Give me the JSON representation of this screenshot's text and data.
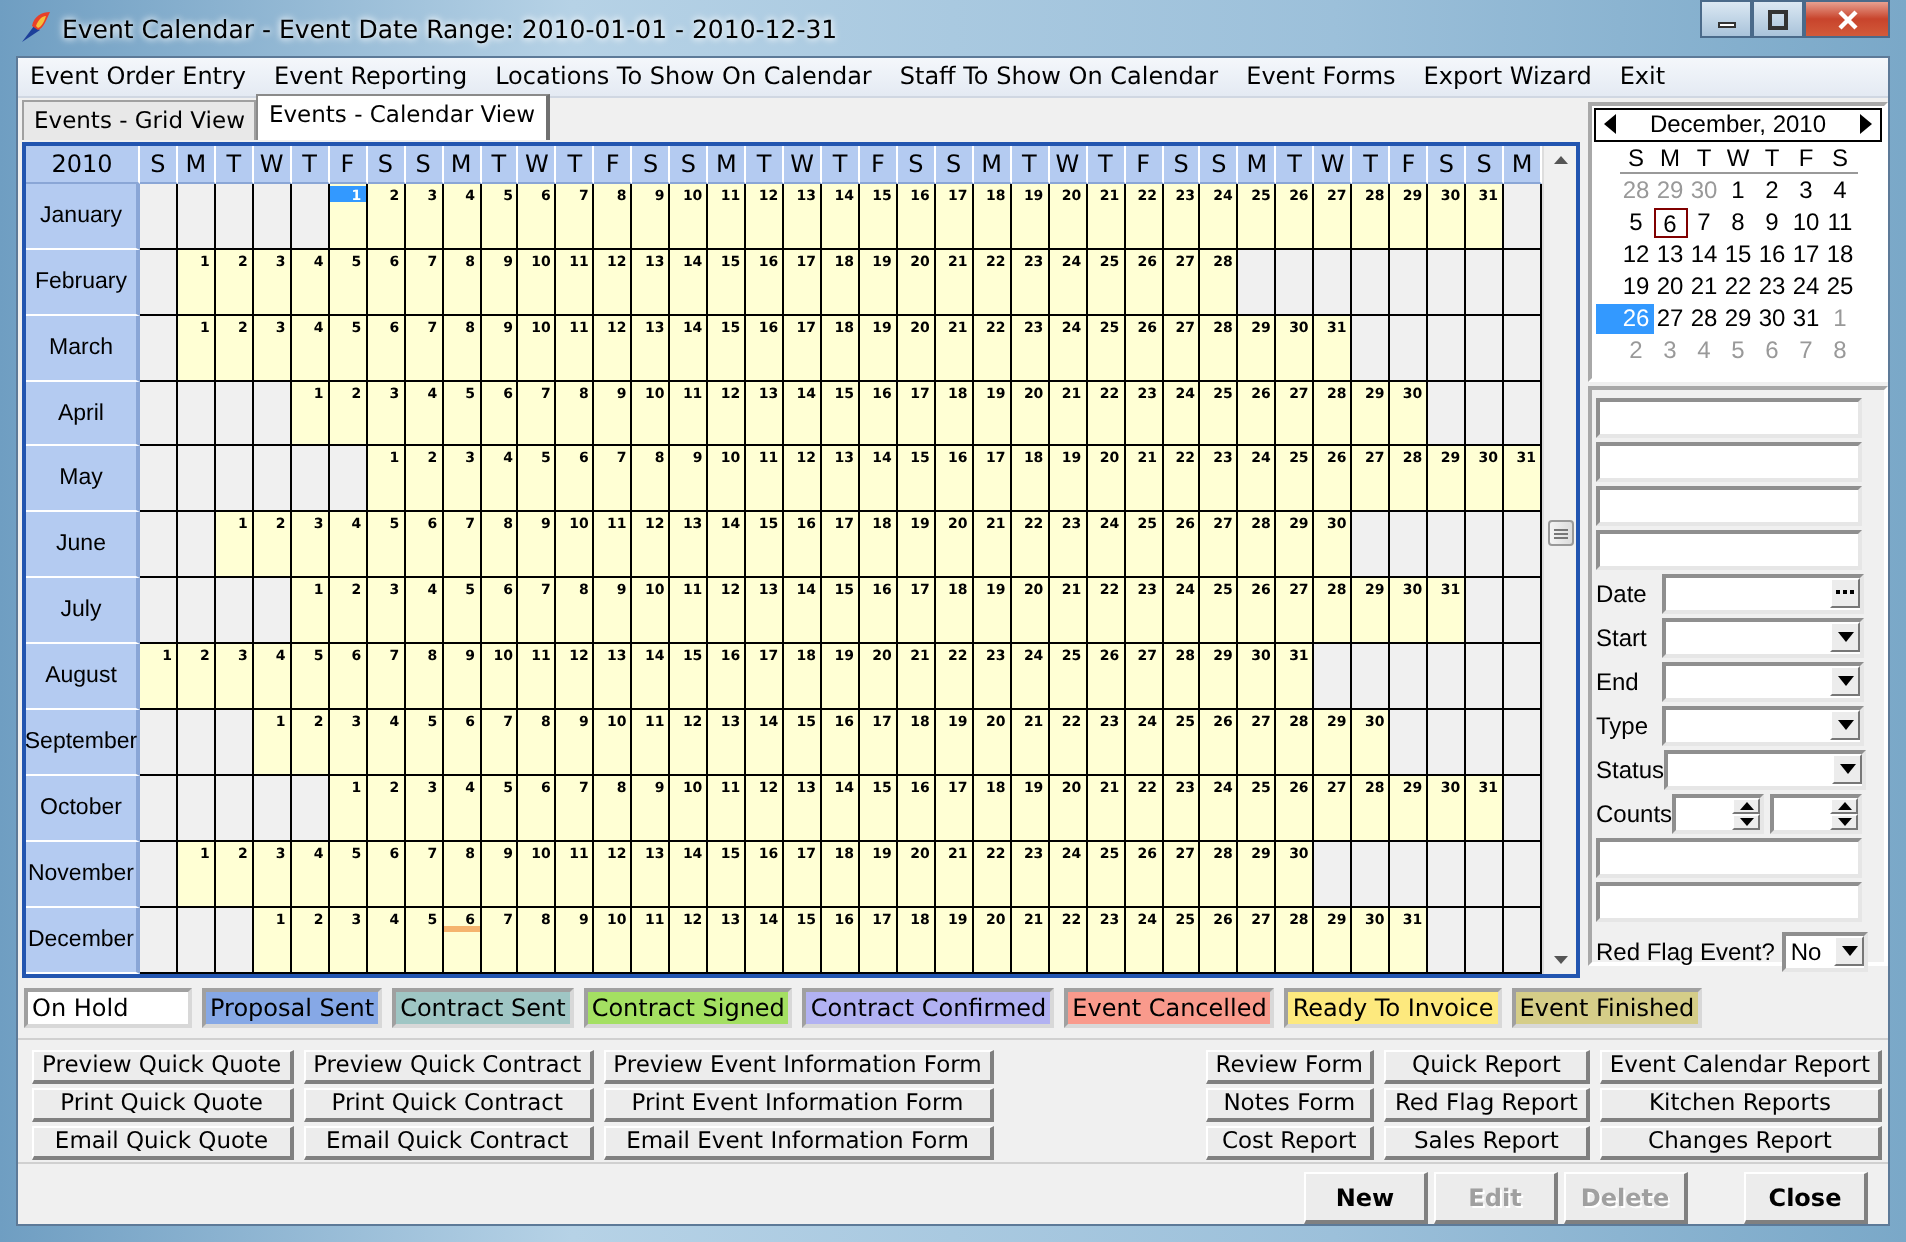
{
  "window": {
    "title": "Event Calendar - Event Date Range: 2010-01-01 - 2010-12-31"
  },
  "menu": [
    "Event Order Entry",
    "Event Reporting",
    "Locations To Show On Calendar",
    "Staff To Show On Calendar",
    "Event Forms",
    "Export Wizard",
    "Exit"
  ],
  "tabs": [
    {
      "label": "Events - Grid View",
      "selected": false
    },
    {
      "label": "Events - Calendar View",
      "selected": true
    }
  ],
  "grid": {
    "year": "2010",
    "weekdays": [
      "S",
      "M",
      "T",
      "W",
      "T",
      "F",
      "S",
      "S",
      "M",
      "T",
      "W",
      "T",
      "F",
      "S",
      "S",
      "M",
      "T",
      "W",
      "T",
      "F",
      "S",
      "S",
      "M",
      "T",
      "W",
      "T",
      "F",
      "S",
      "S",
      "M",
      "T",
      "W",
      "T",
      "F",
      "S",
      "S",
      "M"
    ],
    "months": [
      {
        "name": "January",
        "cells": [
          null,
          null,
          null,
          null,
          null,
          {
            "day": "1",
            "selected": true
          },
          "2",
          "3",
          "4",
          "5",
          "6",
          "7",
          "8",
          "9",
          "10",
          "11",
          "12",
          "13",
          "14",
          "15",
          "16",
          "17",
          "18",
          "19",
          "20",
          "21",
          "22",
          "23",
          "24",
          "25",
          "26",
          "27",
          "28",
          "29",
          "30",
          "31"
        ]
      },
      {
        "name": "February",
        "cells": [
          null,
          "1",
          "2",
          "3",
          "4",
          "5",
          "6",
          "7",
          "8",
          "9",
          "10",
          "11",
          "12",
          "13",
          "14",
          "15",
          "16",
          "17",
          "18",
          "19",
          "20",
          "21",
          "22",
          "23",
          "24",
          "25",
          "26",
          "27",
          "28"
        ]
      },
      {
        "name": "March",
        "cells": [
          null,
          "1",
          "2",
          "3",
          "4",
          "5",
          "6",
          "7",
          "8",
          "9",
          "10",
          "11",
          "12",
          "13",
          "14",
          "15",
          "16",
          "17",
          "18",
          "19",
          "20",
          "21",
          "22",
          "23",
          "24",
          "25",
          "26",
          "27",
          "28",
          "29",
          "30",
          "31"
        ]
      },
      {
        "name": "April",
        "cells": [
          null,
          null,
          null,
          null,
          "1",
          "2",
          "3",
          "4",
          "5",
          "6",
          "7",
          "8",
          "9",
          "10",
          "11",
          "12",
          "13",
          "14",
          "15",
          "16",
          "17",
          "18",
          "19",
          "20",
          "21",
          "22",
          "23",
          "24",
          "25",
          "26",
          "27",
          "28",
          "29",
          "30"
        ]
      },
      {
        "name": "May",
        "cells": [
          null,
          null,
          null,
          null,
          null,
          null,
          "1",
          "2",
          "3",
          "4",
          "5",
          "6",
          "7",
          "8",
          "9",
          "10",
          "11",
          "12",
          "13",
          "14",
          "15",
          "16",
          "17",
          "18",
          "19",
          "20",
          "21",
          "22",
          "23",
          "24",
          "25",
          "26",
          "27",
          "28",
          "29",
          "30",
          "31"
        ]
      },
      {
        "name": "June",
        "cells": [
          null,
          null,
          "1",
          "2",
          "3",
          "4",
          "5",
          "6",
          "7",
          "8",
          "9",
          "10",
          "11",
          "12",
          "13",
          "14",
          "15",
          "16",
          "17",
          "18",
          "19",
          "20",
          "21",
          "22",
          "23",
          "24",
          "25",
          "26",
          "27",
          "28",
          "29",
          "30"
        ]
      },
      {
        "name": "July",
        "cells": [
          null,
          null,
          null,
          null,
          "1",
          "2",
          "3",
          "4",
          "5",
          "6",
          "7",
          "8",
          "9",
          "10",
          "11",
          "12",
          "13",
          "14",
          "15",
          "16",
          "17",
          "18",
          "19",
          "20",
          "21",
          "22",
          "23",
          "24",
          "25",
          "26",
          "27",
          "28",
          "29",
          "30",
          "31"
        ]
      },
      {
        "name": "August",
        "cells": [
          "1",
          "2",
          "3",
          "4",
          "5",
          "6",
          "7",
          "8",
          "9",
          "10",
          "11",
          "12",
          "13",
          "14",
          "15",
          "16",
          "17",
          "18",
          "19",
          "20",
          "21",
          "22",
          "23",
          "24",
          "25",
          "26",
          "27",
          "28",
          "29",
          "30",
          "31"
        ]
      },
      {
        "name": "September",
        "cells": [
          null,
          null,
          null,
          "1",
          "2",
          "3",
          "4",
          "5",
          "6",
          "7",
          "8",
          "9",
          "10",
          "11",
          "12",
          "13",
          "14",
          "15",
          "16",
          "17",
          "18",
          "19",
          "20",
          "21",
          "22",
          "23",
          "24",
          "25",
          "26",
          "27",
          "28",
          "29",
          "30"
        ]
      },
      {
        "name": "October",
        "cells": [
          null,
          null,
          null,
          null,
          null,
          "1",
          "2",
          "3",
          "4",
          "5",
          "6",
          "7",
          "8",
          "9",
          "10",
          "11",
          "12",
          "13",
          "14",
          "15",
          "16",
          "17",
          "18",
          "19",
          "20",
          "21",
          "22",
          "23",
          "24",
          "25",
          "26",
          "27",
          "28",
          "29",
          "30",
          "31"
        ]
      },
      {
        "name": "November",
        "cells": [
          null,
          "1",
          "2",
          "3",
          "4",
          "5",
          "6",
          "7",
          "8",
          "9",
          "10",
          "11",
          "12",
          "13",
          "14",
          "15",
          "16",
          "17",
          "18",
          "19",
          "20",
          "21",
          "22",
          "23",
          "24",
          "25",
          "26",
          "27",
          "28",
          "29",
          "30"
        ]
      },
      {
        "name": "December",
        "cells": [
          null,
          null,
          null,
          "1",
          "2",
          "3",
          "4",
          "5",
          {
            "day": "6",
            "today": true
          },
          "7",
          "8",
          "9",
          "10",
          "11",
          "12",
          "13",
          "14",
          "15",
          "16",
          "17",
          "18",
          "19",
          "20",
          "21",
          "22",
          "23",
          "24",
          "25",
          "26",
          "27",
          "28",
          "29",
          "30",
          "31"
        ]
      }
    ]
  },
  "mini_calendar": {
    "title": "December, 2010",
    "weekdays": [
      "S",
      "M",
      "T",
      "W",
      "T",
      "F",
      "S"
    ],
    "weeks": [
      [
        {
          "day": "28",
          "other_month": true
        },
        {
          "day": "29",
          "other_month": true
        },
        {
          "day": "30",
          "other_month": true
        },
        "1",
        "2",
        "3",
        "4"
      ],
      [
        "5",
        {
          "day": "6",
          "today": true
        },
        "7",
        "8",
        "9",
        "10",
        "11"
      ],
      [
        "12",
        "13",
        "14",
        "15",
        "16",
        "17",
        "18"
      ],
      [
        "19",
        "20",
        "21",
        "22",
        "23",
        "24",
        "25"
      ],
      [
        {
          "day": "26",
          "selected": true
        },
        "27",
        "28",
        "29",
        "30",
        "31",
        {
          "day": "1",
          "other_month": true
        }
      ],
      [
        {
          "day": "2",
          "other_month": true
        },
        {
          "day": "3",
          "other_month": true
        },
        {
          "day": "4",
          "other_month": true
        },
        {
          "day": "5",
          "other_month": true
        },
        {
          "day": "6",
          "other_month": true
        },
        {
          "day": "7",
          "other_month": true
        },
        {
          "day": "8",
          "other_month": true
        }
      ]
    ]
  },
  "side_form": {
    "fields": [
      {
        "kind": "text"
      },
      {
        "kind": "text"
      },
      {
        "kind": "text"
      },
      {
        "kind": "text"
      },
      {
        "kind": "date",
        "label": "Date"
      },
      {
        "kind": "dropdown",
        "label": "Start"
      },
      {
        "kind": "dropdown",
        "label": "End"
      },
      {
        "kind": "dropdown",
        "label": "Type"
      },
      {
        "kind": "dropdown",
        "label": "Status"
      },
      {
        "kind": "spinners",
        "label": "Counts"
      },
      {
        "kind": "text"
      },
      {
        "kind": "text"
      },
      {
        "kind": "inline_dropdown",
        "label": "Red Flag Event?",
        "value": "No"
      }
    ]
  },
  "legend": [
    {
      "label": "On Hold",
      "color": "#ffffff"
    },
    {
      "label": "Proposal Sent",
      "color": "#86a8e6"
    },
    {
      "label": "Contract Sent",
      "color": "#9fc6c4"
    },
    {
      "label": "Contract Signed",
      "color": "#a4e062"
    },
    {
      "label": "Contract Confirmed",
      "color": "#b2b2f2"
    },
    {
      "label": "Event Cancelled",
      "color": "#f99a8c"
    },
    {
      "label": "Ready To Invoice",
      "color": "#fde97e"
    },
    {
      "label": "Event Finished",
      "color": "#d5cd88"
    }
  ],
  "report_buttons": {
    "left": [
      [
        "Preview Quick Quote",
        "Print Quick Quote",
        "Email Quick Quote"
      ],
      [
        "Preview Quick Contract",
        "Print Quick Contract",
        "Email Quick Contract"
      ],
      [
        "Preview Event Information Form",
        "Print Event Information Form",
        "Email Event Information Form"
      ]
    ],
    "right": [
      [
        "Review Form",
        "Notes Form",
        "Cost Report"
      ],
      [
        "Quick Report",
        "Red Flag Report",
        "Sales Report"
      ],
      [
        "Event Calendar Report",
        "Kitchen Reports",
        "Changes Report"
      ]
    ]
  },
  "dialog_buttons": [
    {
      "label": "New",
      "disabled": false
    },
    {
      "label": "Edit",
      "disabled": true
    },
    {
      "label": "Delete",
      "disabled": true
    },
    {
      "label": "Close",
      "disabled": false
    }
  ]
}
